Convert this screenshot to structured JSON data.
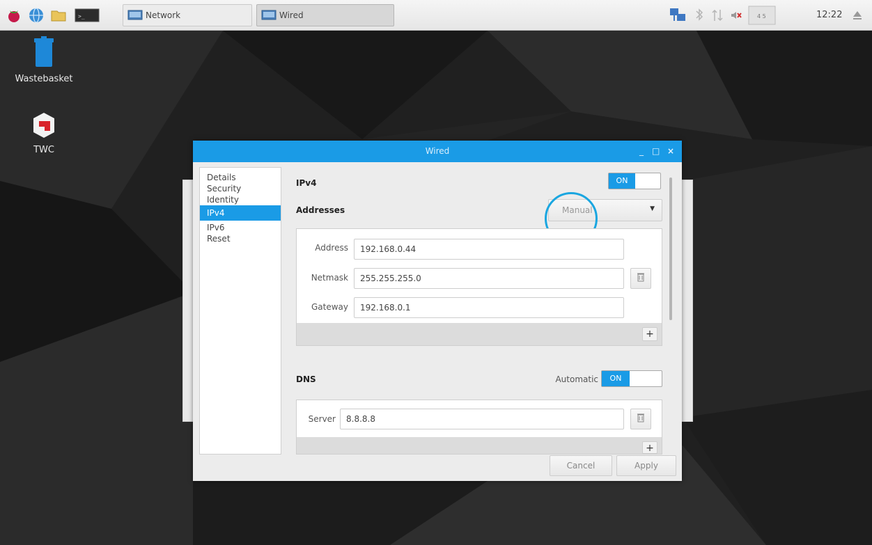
{
  "taskbar": {
    "launchers": [
      {
        "icon": "raspberry-menu-icon"
      },
      {
        "icon": "web-browser-icon"
      },
      {
        "icon": "file-manager-icon"
      },
      {
        "icon": "terminal-icon"
      }
    ],
    "tasks": [
      {
        "label": "Network",
        "icon": "network-window-icon",
        "active": false
      },
      {
        "label": "Wired",
        "icon": "network-window-icon",
        "active": true
      }
    ],
    "tray": [
      {
        "icon": "network-connected-icon"
      },
      {
        "icon": "bluetooth-icon"
      },
      {
        "icon": "transfer-arrows-icon"
      },
      {
        "icon": "volume-muted-icon"
      },
      {
        "icon": "cpu-monitor-icon"
      },
      {
        "icon": "eject-icon"
      }
    ],
    "clock": "12:22"
  },
  "desktop": {
    "icons": [
      {
        "label": "Wastebasket",
        "icon": "wastebasket-icon"
      },
      {
        "label": "TWC",
        "icon": "twc-app-icon"
      }
    ]
  },
  "window": {
    "title": "Wired",
    "accent_color": "#1a9be6",
    "sidebar": {
      "items": [
        {
          "label": "Details",
          "selected": false
        },
        {
          "label": "Security",
          "selected": false
        },
        {
          "label": "Identity",
          "selected": false
        },
        {
          "label": "IPv4",
          "selected": true
        },
        {
          "label": "IPv6",
          "selected": false
        },
        {
          "label": "Reset",
          "selected": false
        }
      ]
    },
    "ipv4": {
      "heading": "IPv4",
      "toggle_label": "ON",
      "toggle_on": true,
      "addresses_heading": "Addresses",
      "method": "Manual",
      "rows": [
        {
          "label": "Address",
          "value": "192.168.0.44"
        },
        {
          "label": "Netmask",
          "value": "255.255.255.0"
        },
        {
          "label": "Gateway",
          "value": "192.168.0.1"
        }
      ],
      "add_label": "+"
    },
    "dns": {
      "heading": "DNS",
      "automatic_label": "Automatic",
      "toggle_label": "ON",
      "toggle_on": true,
      "server_label": "Server",
      "server_value": "8.8.8.8",
      "add_label": "+"
    },
    "buttons": {
      "cancel": "Cancel",
      "apply": "Apply"
    }
  }
}
